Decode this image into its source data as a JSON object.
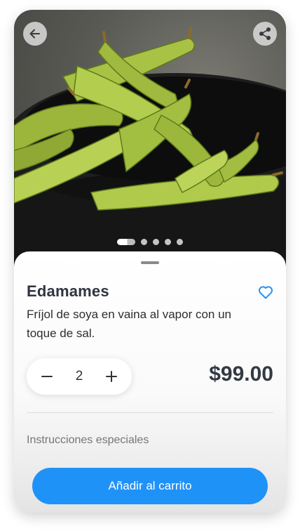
{
  "hero": {
    "image_subject": "edamame pods in a black bowl",
    "back_icon": "arrow-left-icon",
    "share_icon": "share-icon",
    "carousel": {
      "count": 5,
      "active_index": 0
    }
  },
  "product": {
    "name": "Edamames",
    "description": "Fríjol de soya en vaina al vapor con un toque de sal.",
    "favorite_icon": "heart-outline-icon",
    "price": "$99.00"
  },
  "stepper": {
    "quantity": "2",
    "decrement_icon": "minus-icon",
    "increment_icon": "plus-icon"
  },
  "instructions": {
    "placeholder": "Instrucciones especiales",
    "value": ""
  },
  "cta": {
    "label": "Añadir al carrito"
  },
  "colors": {
    "accent": "#1F92F8",
    "text_dark": "#2E3440",
    "placeholder": "#C2C2C2"
  }
}
